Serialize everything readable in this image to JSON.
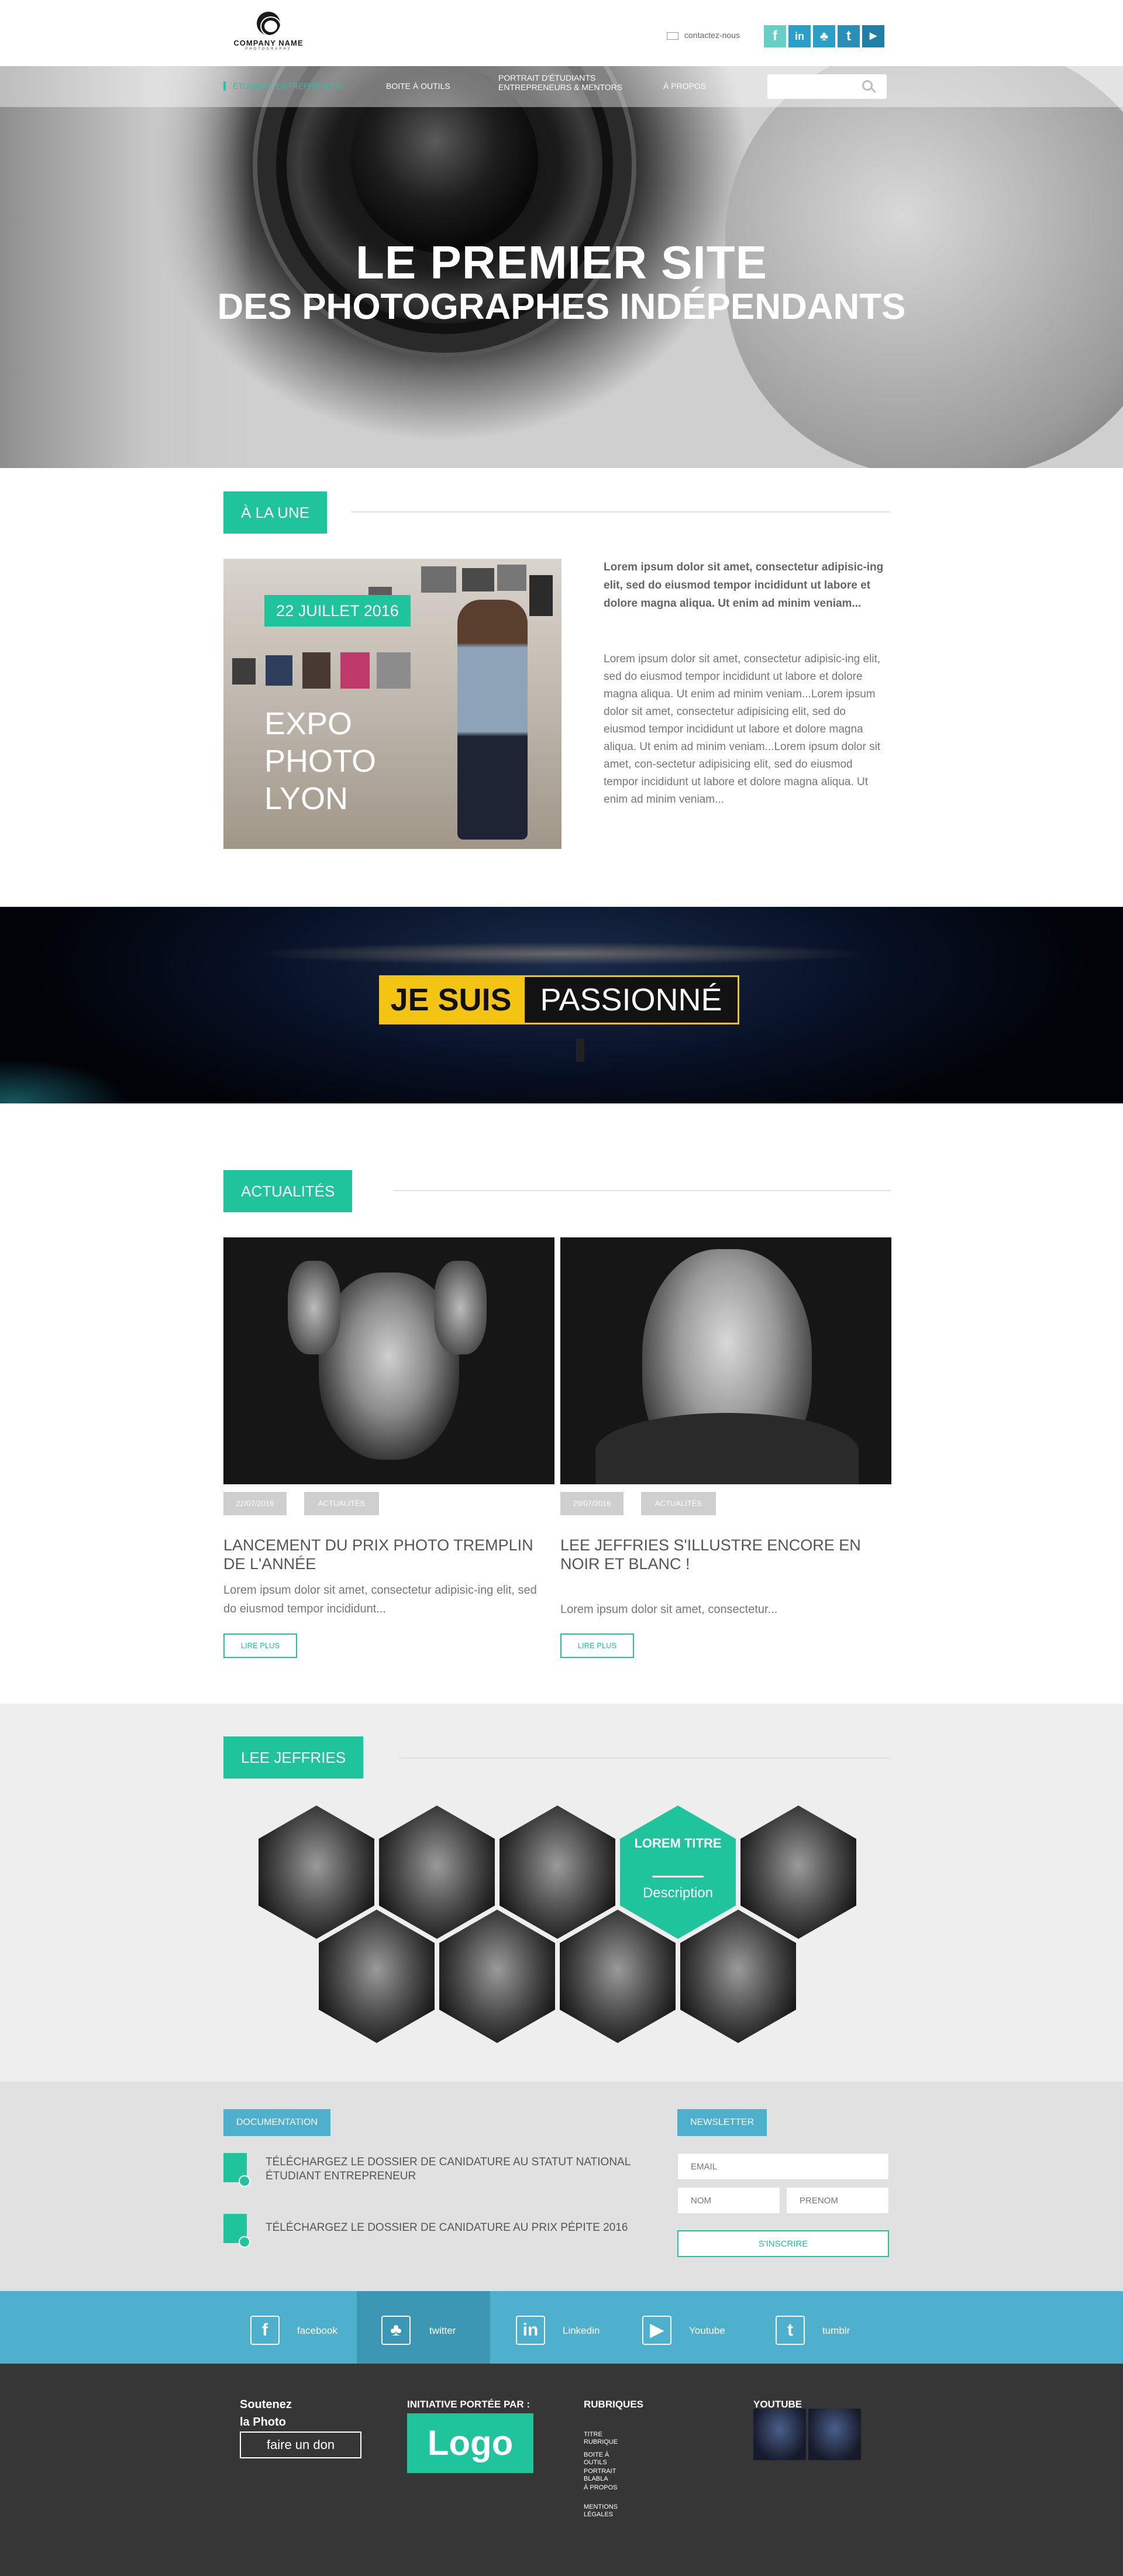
{
  "header": {
    "logo_name": "COMPANY NAME",
    "logo_sub": "PHOTOGRAPHY",
    "contact_label": "contactez-nous",
    "social": [
      {
        "icon": "facebook-icon",
        "glyph": "f",
        "color": "#66d0c6"
      },
      {
        "icon": "linkedin-icon",
        "glyph": "in",
        "color": "#2aa0c8"
      },
      {
        "icon": "twitter-icon",
        "glyph": "♣",
        "color": "#2aa0c8"
      },
      {
        "icon": "tumblr-icon",
        "glyph": "t",
        "color": "#2a8fb6"
      },
      {
        "icon": "youtube-icon",
        "glyph": "▶",
        "color": "#1f7fa5"
      }
    ]
  },
  "nav": {
    "items": [
      "ÉTUDIANT ENTREPRENEUR",
      "BOITE À OUTILS",
      "PORTRAIT D'ÉTUDIANTS ENTREPRENEURS & MENTORS",
      "À PROPOS"
    ],
    "item_lines": [
      [
        "ÉTUDIANT ENTREPRENEUR"
      ],
      [
        "BOITE À OUTILS"
      ],
      [
        "PORTRAIT D'ÉTUDIANTS",
        "ENTREPRENEURS & MENTORS"
      ],
      [
        "À PROPOS"
      ]
    ],
    "active_index": 0,
    "search_placeholder": ""
  },
  "hero": {
    "title_line1": "LE PREMIER SITE",
    "title_line2": "DES PHOTOGRAPHES INDÉPENDANTS"
  },
  "une": {
    "section_label": "À LA UNE",
    "date": "22 JUILLET 2016",
    "image_caption": "EXPO PHOTO LYON",
    "caption_lines": [
      "EXPO",
      "PHOTO",
      "LYON"
    ],
    "intro": "Lorem ipsum dolor sit amet, consectetur adipisic-ing elit, sed do eiusmod tempor incididunt ut labore et dolore magna aliqua. Ut enim ad minim veniam...",
    "body": "Lorem ipsum dolor sit amet, consectetur adipisic-ing elit, sed do eiusmod tempor incididunt ut labore et dolore magna aliqua. Ut enim ad minim veniam...Lorem ipsum dolor sit amet, consectetur adipisicing elit, sed do eiusmod tempor incididunt ut labore et dolore magna aliqua. Ut enim ad minim veniam...Lorem ipsum dolor sit amet, con-sectetur adipisicing elit, sed do eiusmod tempor incididunt ut labore et dolore magna aliqua. Ut enim ad minim veniam..."
  },
  "banner": {
    "word1": "JE SUIS",
    "word2": "PASSIONNÉ"
  },
  "actualites": {
    "section_label": "ACTUALITÉS",
    "cards": [
      {
        "date": "22/07/2016",
        "tag": "ACTUALITÉS",
        "title": "LANCEMENT DU PRIX PHOTO TREMPLIN DE L'ANNÉE",
        "text": "Lorem ipsum dolor sit amet, consectetur adipisic-ing elit, sed do eiusmod tempor incididunt...",
        "button": "LIRE PLUS"
      },
      {
        "date": "29/07/2016",
        "tag": "ACTUALITÉS",
        "title": "LEE JEFFRIES S'ILLUSTRE ENCORE EN NOIR ET BLANC !",
        "text": "Lorem ipsum dolor sit amet, consectetur...",
        "button": "LIRE PLUS"
      }
    ]
  },
  "lee": {
    "section_label": "LEE JEFFRIES",
    "featured_title": "LOREM TITRE",
    "featured_desc": "Description"
  },
  "docs": {
    "label": "DOCUMENTATION",
    "items": [
      "TÉLÉCHARGEZ LE DOSSIER DE CANIDATURE AU STATUT NATIONAL ÉTUDIANT ENTREPRENEUR",
      "TÉLÉCHARGEZ LE DOSSIER DE CANIDATURE AU PRIX PÉPITE 2016"
    ]
  },
  "newsletter": {
    "label": "NEWSLETTER",
    "email_placeholder": "EMAIL",
    "nom_placeholder": "NOM",
    "prenom_placeholder": "PRENOM",
    "button": "S'INSCRIRE"
  },
  "socialbar": {
    "items": [
      {
        "glyph": "f",
        "label": "facebook",
        "icon": "facebook-icon"
      },
      {
        "glyph": "♣",
        "label": "twitter",
        "icon": "twitter-icon"
      },
      {
        "glyph": "in",
        "label": "Linkedin",
        "icon": "linkedin-icon"
      },
      {
        "glyph": "▶",
        "label": "Youtube",
        "icon": "youtube-icon"
      },
      {
        "glyph": "t",
        "label": "tumblr",
        "icon": "tumblr-icon"
      }
    ],
    "active_index": 1
  },
  "footer": {
    "support_title": "Soutenez la Photo",
    "support_lines": [
      "Soutenez",
      "la Photo"
    ],
    "donate_button": "faire un don",
    "initiative_title": "INITIATIVE PORTÉE PAR :",
    "initiative_logo": "Logo",
    "rubriques_title": "RUBRIQUES",
    "rubriques": [
      "TITRE RUBRIQUE",
      "BOITE À OUTILS",
      "PORTRAIT BLABLA",
      "À PROPOS",
      "MENTIONS LÉGALES"
    ],
    "youtube_title": "YOUTUBE"
  }
}
